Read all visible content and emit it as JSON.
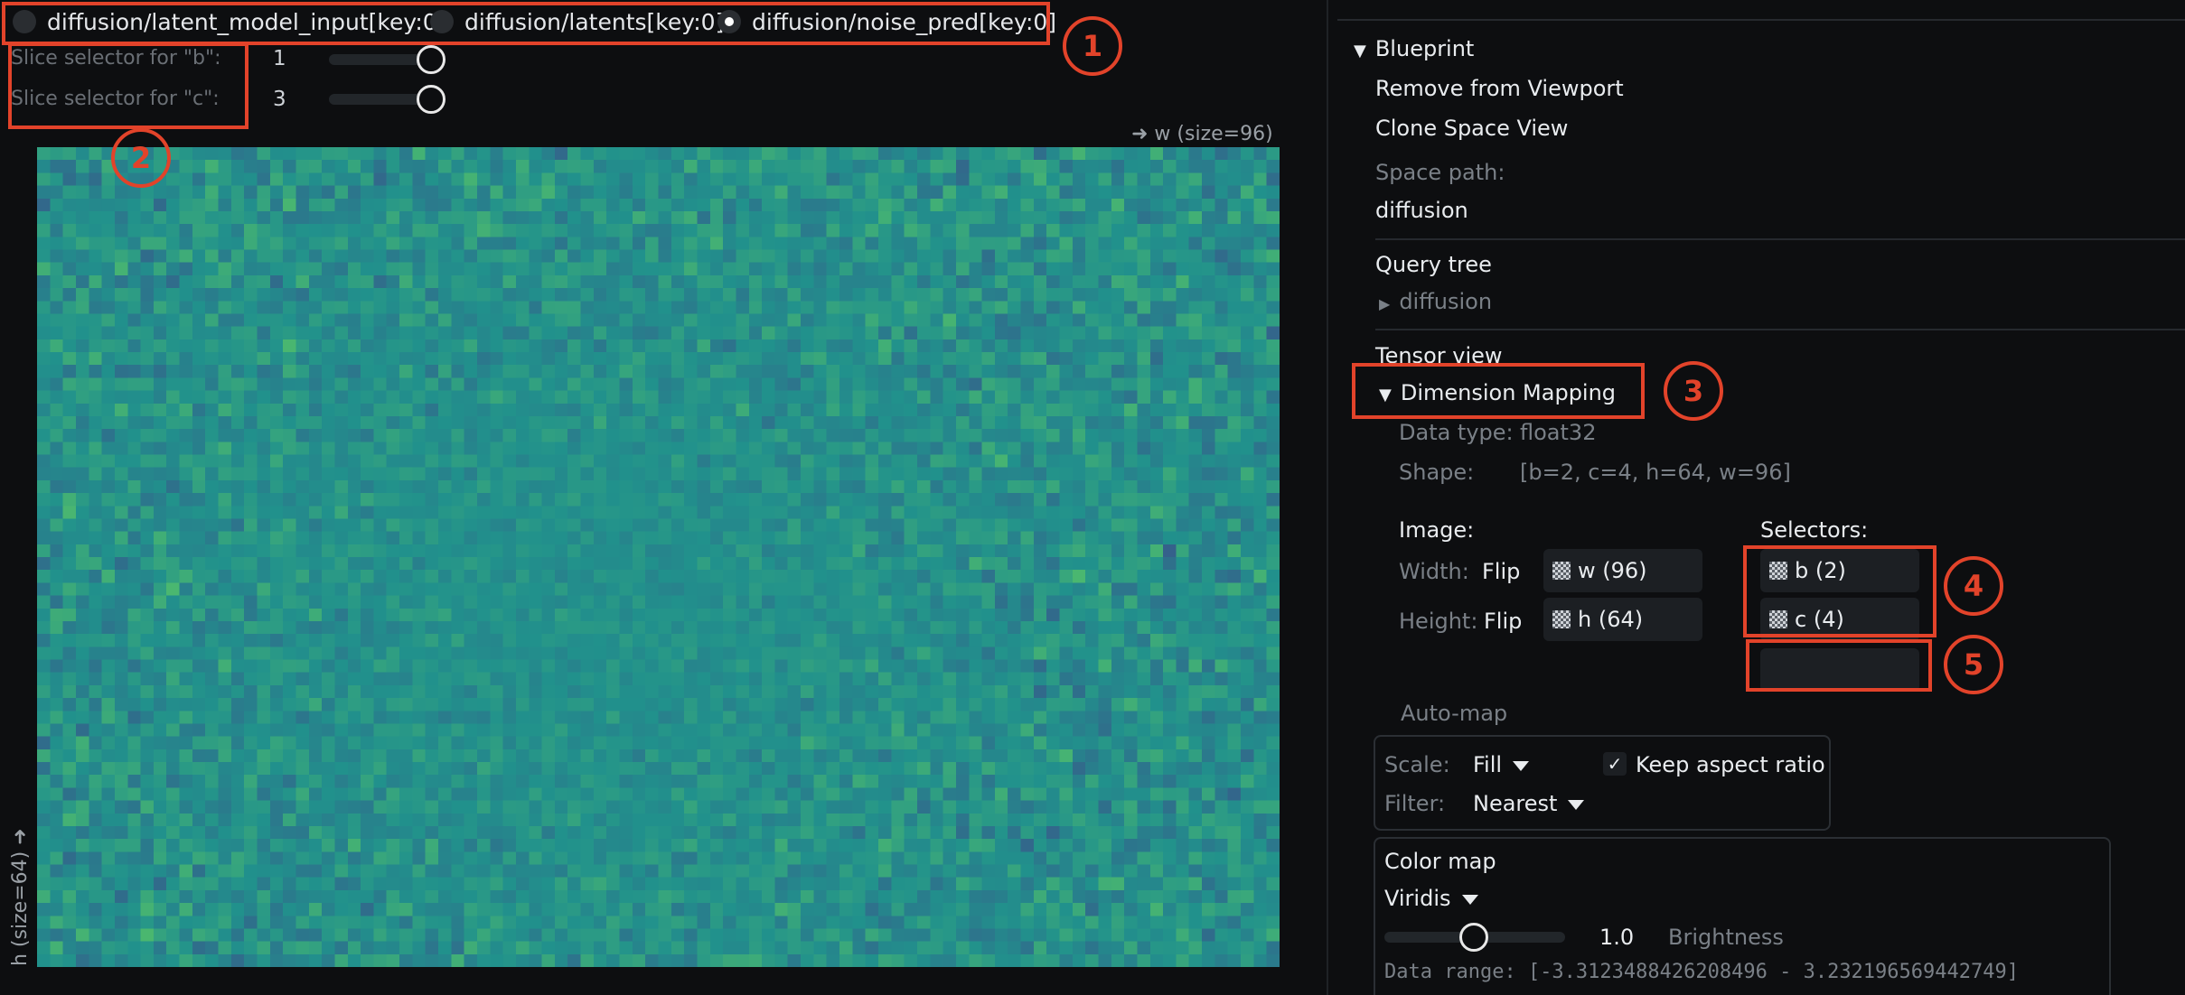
{
  "tensor_view": {
    "tabs": [
      {
        "label": "diffusion/latent_model_input[key:0]",
        "selected": false
      },
      {
        "label": "diffusion/latents[key:0]",
        "selected": false
      },
      {
        "label": "diffusion/noise_pred[key:0]",
        "selected": true
      }
    ],
    "slice_selectors": [
      {
        "label": "Slice selector for \"b\":",
        "value": "1",
        "fraction": 1.0
      },
      {
        "label": "Slice selector for \"c\":",
        "value": "3",
        "fraction": 1.0
      }
    ],
    "width_axis_label": "➜ w (size=96)",
    "height_axis_label": "h (size=64) ➜",
    "grid": {
      "cols": 96,
      "rows": 64
    },
    "colormap": "viridis"
  },
  "annotations": [
    "1",
    "2",
    "3",
    "4",
    "5"
  ],
  "panel": {
    "blueprint": {
      "header": "Blueprint",
      "remove": "Remove from Viewport",
      "clone": "Clone Space View",
      "space_path_label": "Space path:",
      "space_path_value": "diffusion"
    },
    "query_tree": {
      "header": "Query tree",
      "item": "diffusion"
    },
    "tensor_view_header": "Tensor view",
    "dimension_mapping": {
      "header": "Dimension Mapping",
      "data_type_label": "Data type:",
      "data_type_value": "float32",
      "shape_label": "Shape:",
      "shape_value": "[b=2, c=4, h=64, w=96]",
      "image_label": "Image:",
      "width_label": "Width:",
      "height_label": "Height:",
      "flip_label": "Flip",
      "width_dim": "w (96)",
      "height_dim": "h (64)",
      "selectors_label": "Selectors:",
      "selectors": [
        "b (2)",
        "c (4)"
      ],
      "auto_map": "Auto-map"
    },
    "scale": {
      "scale_label": "Scale:",
      "scale_value": "Fill",
      "keep_aspect": "Keep aspect ratio",
      "keep_aspect_checked": true,
      "filter_label": "Filter:",
      "filter_value": "Nearest"
    },
    "color_map": {
      "header": "Color map",
      "value": "Viridis",
      "brightness_value": "1.0",
      "brightness_label": "Brightness",
      "brightness_fraction": 0.5,
      "data_range": "Data range: [-3.3123488426208496 - 3.232196569442749]"
    }
  },
  "colors": {
    "annotation": "#e2432a",
    "background": "#0d0e10",
    "text": "#e9ecef"
  }
}
